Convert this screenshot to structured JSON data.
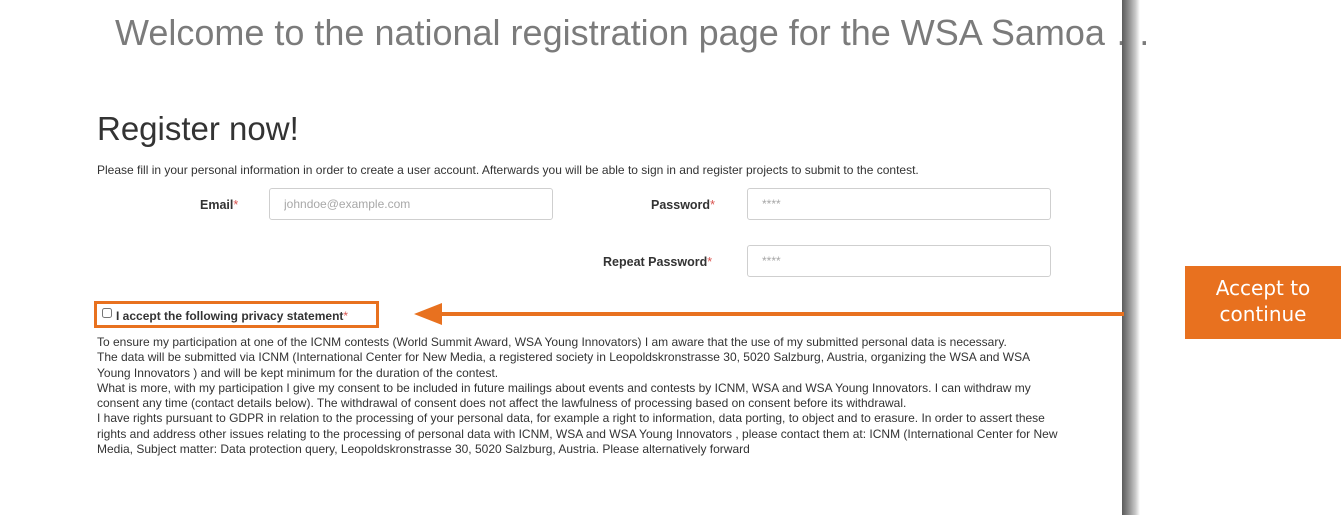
{
  "header": {
    "welcome_title": "Welcome to the national registration page for the WSA Samoa …"
  },
  "register": {
    "title": "Register now!",
    "intro": "Please fill in your personal information in order to create a user account. Afterwards you will be able to sign in and register projects to submit to the contest."
  },
  "form": {
    "required_mark": "*",
    "email": {
      "label": "Email",
      "placeholder": "johndoe@example.com"
    },
    "password": {
      "label": "Password",
      "placeholder": "****"
    },
    "repeat_password": {
      "label": "Repeat Password",
      "placeholder": "****"
    }
  },
  "privacy": {
    "accept_label": "I accept the following privacy statement",
    "paragraphs": [
      "To ensure my participation at one of the ICNM contests (World Summit Award, WSA Young Innovators) I am aware that the use of my submitted personal data is necessary.",
      "The data will be submitted via ICNM (International Center for New Media, a registered society in Leopoldskronstrasse 30, 5020 Salzburg, Austria, organizing the WSA and WSA Young Innovators ) and will be kept minimum for the duration of the contest.",
      "What is more, with my participation I give my consent to be included in future mailings about events and contests by ICNM, WSA and WSA Young Innovators. I can withdraw my consent any time (contact details below). The withdrawal of consent does not affect the lawfulness of processing based on consent before its withdrawal.",
      "I have rights pursuant to GDPR in relation to the processing of your personal data, for example a right to information, data porting, to object and to erasure. In order to assert these rights and address other issues relating to the processing of personal data with ICNM, WSA and WSA Young Innovators , please contact them at: ICNM (International Center for New Media, Subject matter: Data protection query, Leopoldskronstrasse 30, 5020 Salzburg, Austria. Please alternatively forward"
    ]
  },
  "callout": {
    "line1": "Accept to",
    "line2": "continue"
  },
  "colors": {
    "accent": "#e8711f",
    "required": "#d9534f",
    "heading_gray": "#7b7b7b",
    "text": "#333333"
  }
}
